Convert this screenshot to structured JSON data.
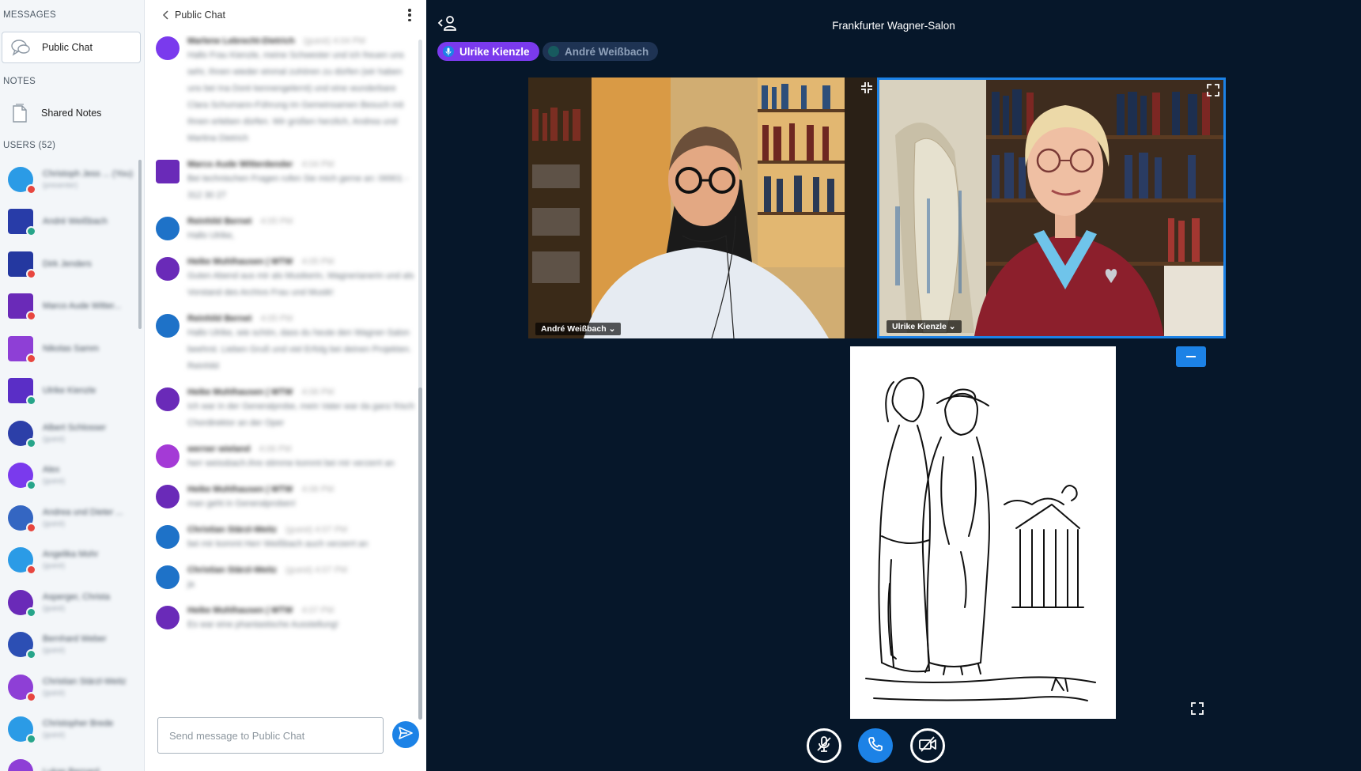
{
  "sidebar": {
    "messages_title": "MESSAGES",
    "public_chat": "Public Chat",
    "notes_title": "NOTES",
    "shared_notes": "Shared Notes",
    "users_title": "USERS (52)"
  },
  "chat": {
    "title": "Public Chat",
    "input_placeholder": "Send message to Public Chat"
  },
  "meeting": {
    "title": "Frankfurter Wagner-Salon"
  },
  "talking": [
    {
      "name": "Ulrike Kienzle",
      "active": true
    },
    {
      "name": "André Weißbach",
      "active": false
    }
  ],
  "videos": [
    {
      "name": "André Weißbach ⌄"
    },
    {
      "name": "Ulrike Kienzle ⌄"
    }
  ],
  "colors": {
    "accent": "#1c82e6",
    "talking": "#7a3aed",
    "stage_bg": "#06172a"
  }
}
